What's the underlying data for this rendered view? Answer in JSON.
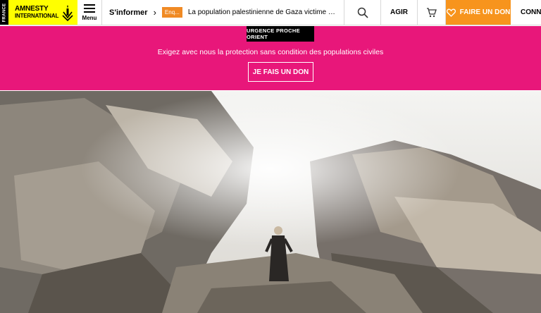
{
  "header": {
    "country": "FRANCE",
    "logo_line1": "AMNESTY",
    "logo_line2": "INTERNATIONAL",
    "menu_label": "Menu",
    "breadcrumb_section": "S'informer",
    "breadcrumb_tag": "Enq...",
    "breadcrumb_title": "La population palestinienne de Gaza victime d'un gén...",
    "agir_label": "AGIR",
    "donate_label": "FAIRE UN DON",
    "connect_label": "CONNEX"
  },
  "banner": {
    "badge": "URGENCE PROCHE ORIENT",
    "text": "Exigez avec nous la protection sans condition des populations civiles",
    "cta": "JE FAIS UN DON"
  },
  "colors": {
    "brand_yellow": "#ffff00",
    "banner_pink": "#e8177a",
    "donate_orange": "#f7941d",
    "tag_orange": "#f08a24"
  },
  "icons": [
    "amnesty-candle-icon",
    "hamburger-icon",
    "chevron-right-icon",
    "search-icon",
    "cart-icon",
    "heart-icon",
    "lock-icon"
  ]
}
